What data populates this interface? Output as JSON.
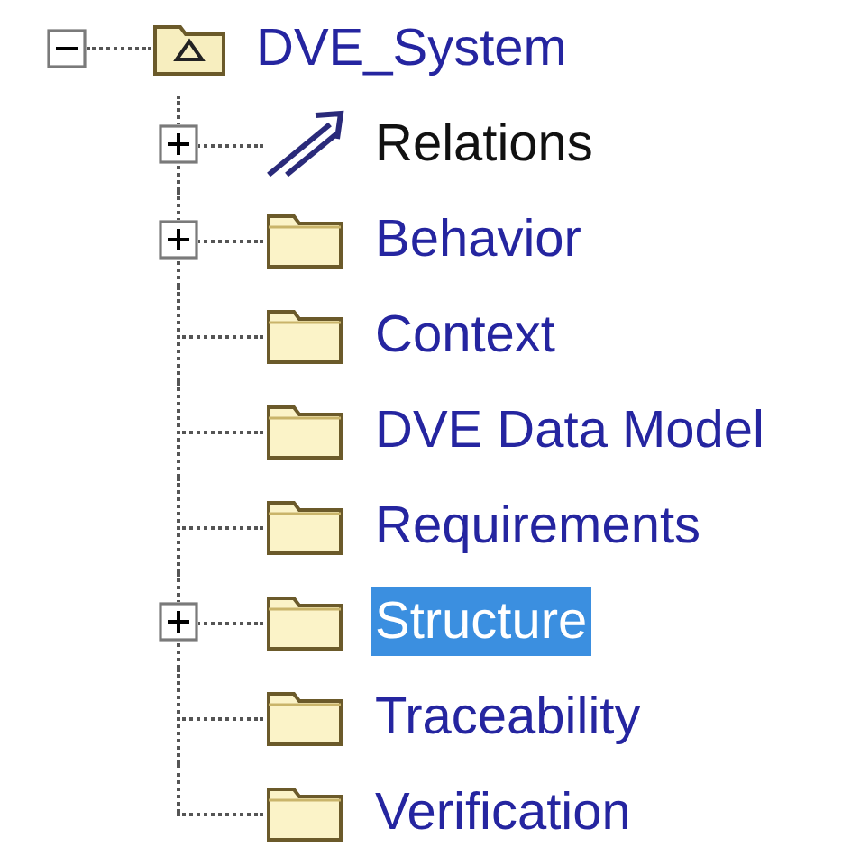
{
  "tree": {
    "label": "DVE_System",
    "kind": "model",
    "expanded": true,
    "selected": false,
    "children": [
      {
        "label": "Relations",
        "kind": "relations",
        "expanded": false,
        "selected": false
      },
      {
        "label": "Behavior",
        "kind": "package",
        "expanded": false,
        "selected": false
      },
      {
        "label": "Context",
        "kind": "package",
        "selected": false
      },
      {
        "label": "DVE Data Model",
        "kind": "package",
        "selected": false
      },
      {
        "label": "Requirements",
        "kind": "package",
        "selected": false
      },
      {
        "label": "Structure",
        "kind": "package",
        "expanded": false,
        "selected": true
      },
      {
        "label": "Traceability",
        "kind": "package",
        "selected": false
      },
      {
        "label": "Verification",
        "kind": "package",
        "selected": false
      }
    ]
  }
}
